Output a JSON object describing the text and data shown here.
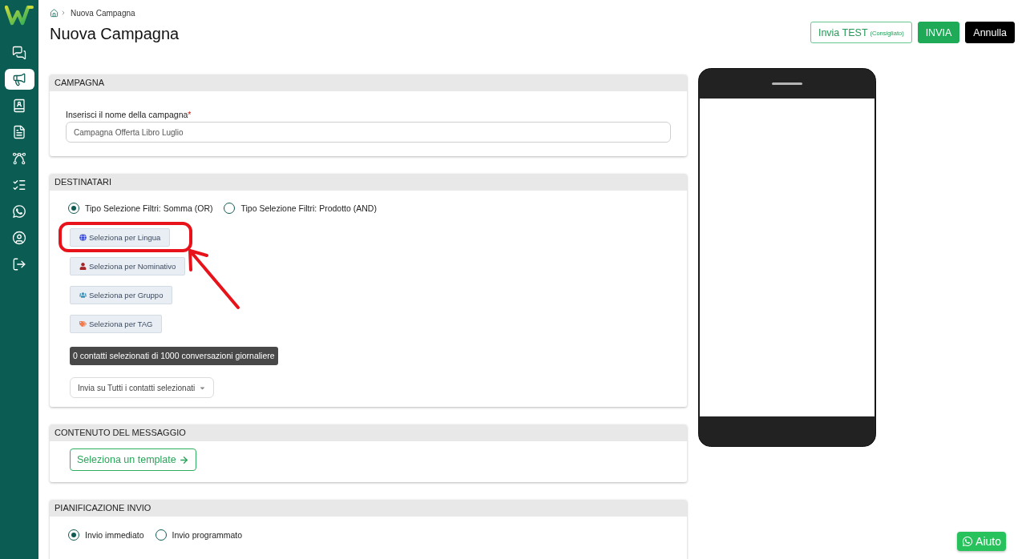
{
  "sidebar": {
    "items": [
      {
        "kind": "chat",
        "selected": false
      },
      {
        "kind": "campaigns",
        "selected": true
      },
      {
        "kind": "contacts",
        "selected": false
      },
      {
        "kind": "documents",
        "selected": false
      },
      {
        "kind": "flows",
        "selected": false
      },
      {
        "kind": "tasks",
        "selected": false
      },
      {
        "kind": "whatsapp",
        "selected": false
      },
      {
        "kind": "account",
        "selected": false
      },
      {
        "kind": "logout",
        "selected": false
      }
    ]
  },
  "breadcrumb": {
    "current": "Nuova Campagna"
  },
  "title": "Nuova Campagna",
  "actions": [
    {
      "kind": "outline",
      "label": "Invia TEST",
      "note": "(Consigliato)"
    },
    {
      "kind": "primary",
      "label": "INVIA"
    },
    {
      "kind": "dark",
      "label": "Annulla"
    }
  ],
  "campaign": {
    "title": "CAMPAGNA",
    "field_label": "Inserisci il nome della campagna",
    "required_mark": "*",
    "value": "Campagna Offerta Libro Luglio"
  },
  "recipients": {
    "title": "DESTINATARI",
    "modes": [
      {
        "label": "Tipo Selezione Filtri: Somma (OR)",
        "selected": true
      },
      {
        "label": "Tipo Selezione Filtri: Prodotto (AND)",
        "selected": false
      }
    ],
    "filters": [
      {
        "kind": "language",
        "label": "Seleziona per Lingua",
        "highlighted": true
      },
      {
        "kind": "contact",
        "label": "Seleziona per Nominativo",
        "highlighted": false
      },
      {
        "kind": "group",
        "label": "Seleziona per Gruppo",
        "highlighted": false
      },
      {
        "kind": "tag",
        "label": "Seleziona per TAG",
        "highlighted": false
      }
    ],
    "counter": "0 contatti selezionati di 1000 conversazioni giornaliere",
    "send_to": "Invia su Tutti i contatti selezionati"
  },
  "content": {
    "title": "CONTENUTO DEL MESSAGGIO",
    "template_button": "Seleziona un template"
  },
  "schedule": {
    "title": "PIANIFICAZIONE INVIO",
    "options": [
      {
        "label": "Invio immediato",
        "selected": true
      },
      {
        "label": "Invio programmato",
        "selected": false
      }
    ]
  },
  "help_button": "Aiuto"
}
